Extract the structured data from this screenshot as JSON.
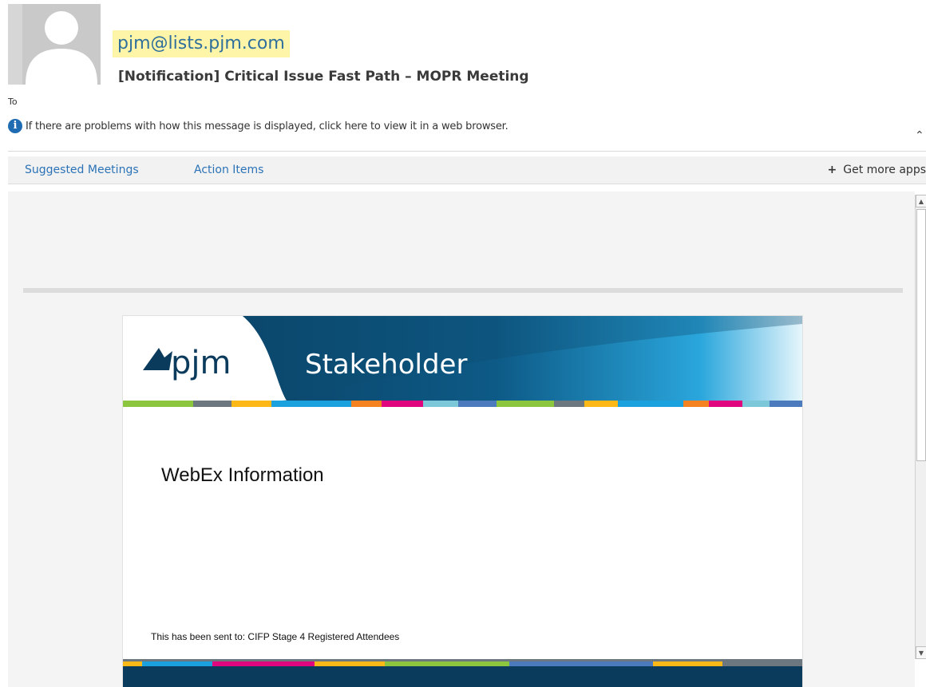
{
  "header": {
    "sender": "pjm@lists.pjm.com",
    "subject": "[Notification] Critical Issue Fast Path – MOPR Meeting",
    "to_label": "To",
    "info_message": "If there are problems with how this message is displayed, click here to view it in a web browser.",
    "info_icon_glyph": "i"
  },
  "apps_bar": {
    "suggested_meetings": "Suggested Meetings",
    "action_items": "Action Items",
    "get_more_apps": "Get more apps",
    "plus_glyph": "+"
  },
  "email": {
    "banner": {
      "logo_text": "pjm",
      "title": "Stakeholder"
    },
    "heading": "WebEx Information",
    "sent_to": "This has been sent to: CIFP Stage 4 Registered Attendees"
  },
  "colors": {
    "sender_highlight": "#fff5a8",
    "link_blue": "#2b73b6",
    "banner_navy": "#0b3b5c",
    "stripe": [
      "#8cc63f",
      "#6d7780",
      "#fbb817",
      "#1ba1de",
      "#e0067d",
      "#7cc7d8",
      "#4b7bbd",
      "#f58220"
    ]
  },
  "icons": {
    "avatar": "person-silhouette",
    "info": "info-circle-icon",
    "collapse": "chevron-up-icon",
    "add": "plus-icon",
    "scroll_up": "scroll-up-arrow",
    "scroll_down": "scroll-down-arrow"
  }
}
